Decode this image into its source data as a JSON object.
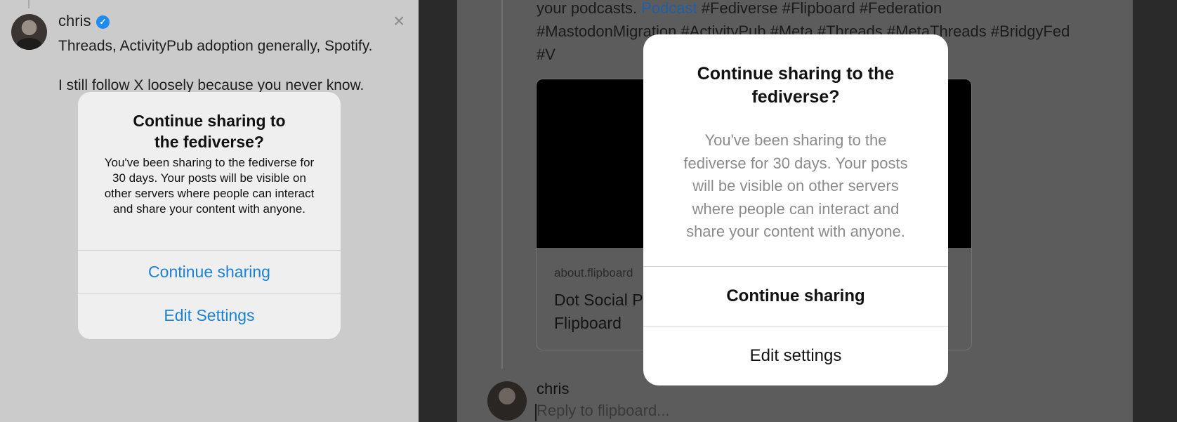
{
  "left": {
    "username": "chris",
    "post_lines": [
      "Threads, ActivityPub adoption generally, Spotify.",
      "I still follow X loosely because you never know."
    ],
    "dialog": {
      "title": "Continue sharing to the fediverse?",
      "body": "You've been sharing to the fediverse for 30 days. Your posts will be visible on other servers where people can interact and share your content with anyone.",
      "primary_button": "Continue sharing",
      "secondary_button": "Edit Settings"
    }
  },
  "right": {
    "post_text_pre": "your podcasts. ",
    "post_link": "Podcast",
    "post_text_post": " #Fediverse #Flipboard #Federation #MastodonMigration #ActivityPub #Meta #Threads #MetaThreads #BridgyFed #V",
    "card": {
      "domain": "about.flipboard",
      "title": "Dot Social P Flipboard"
    },
    "reply_user": "chris",
    "reply_placeholder": "Reply to flipboard...",
    "dialog": {
      "title": "Continue sharing to the fediverse?",
      "body": "You've been sharing to the fediverse for 30 days. Your posts will be visible on other servers where people can interact and share your content with anyone.",
      "primary_button": "Continue sharing",
      "secondary_button": "Edit settings"
    }
  },
  "colors": {
    "accent_blue": "#1a82d8",
    "verified_blue": "#1d8cf0"
  }
}
